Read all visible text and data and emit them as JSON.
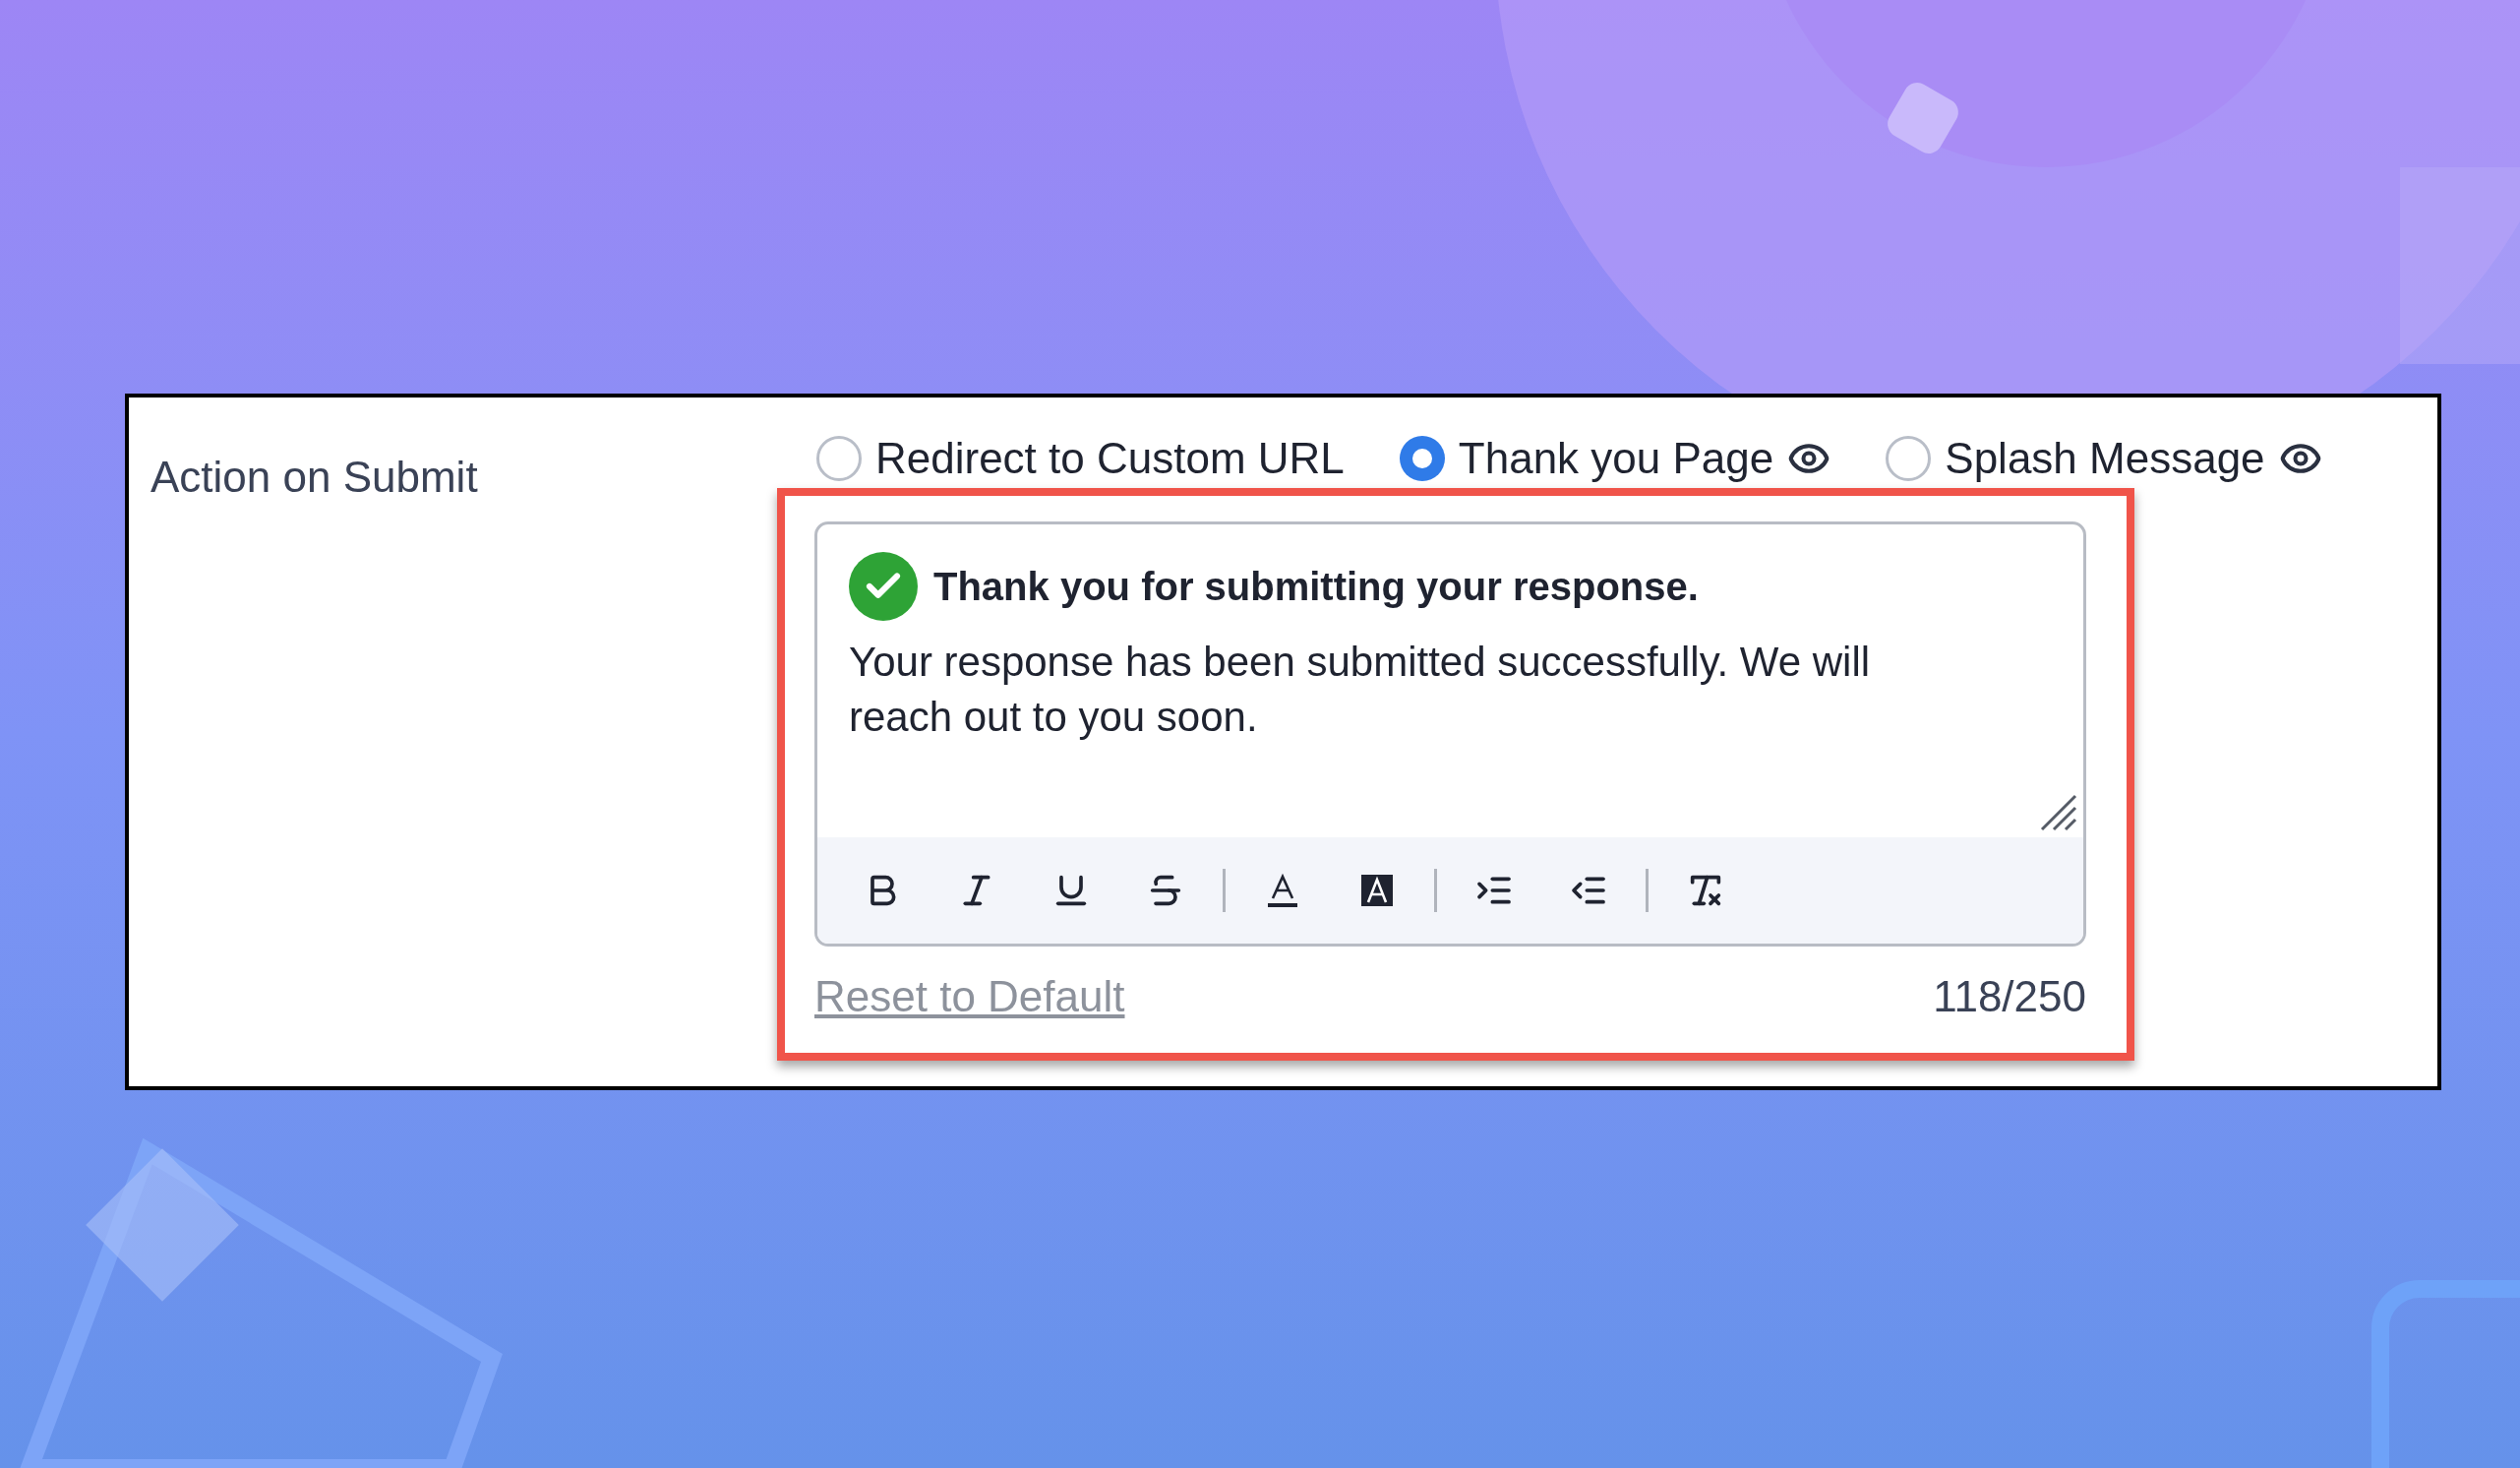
{
  "field_label": "Action on Submit",
  "options": [
    {
      "label": "Redirect to Custom URL",
      "selected": false,
      "preview": false
    },
    {
      "label": "Thank you Page",
      "selected": true,
      "preview": true
    },
    {
      "label": "Splash Message",
      "selected": false,
      "preview": true
    }
  ],
  "message": {
    "title": "Thank you for submitting your response.",
    "body": "Your response has been submitted successfully. We will reach out to you soon."
  },
  "toolbar": [
    {
      "buttons": [
        {
          "kind": "bold"
        },
        {
          "kind": "italic"
        },
        {
          "kind": "underline"
        },
        {
          "kind": "strikethrough"
        }
      ]
    },
    {
      "buttons": [
        {
          "kind": "text-color"
        },
        {
          "kind": "background-color"
        }
      ]
    },
    {
      "buttons": [
        {
          "kind": "indent"
        },
        {
          "kind": "outdent"
        }
      ]
    },
    {
      "buttons": [
        {
          "kind": "clear-format"
        }
      ]
    }
  ],
  "reset_link": "Reset to Default",
  "char_count": "118/250"
}
